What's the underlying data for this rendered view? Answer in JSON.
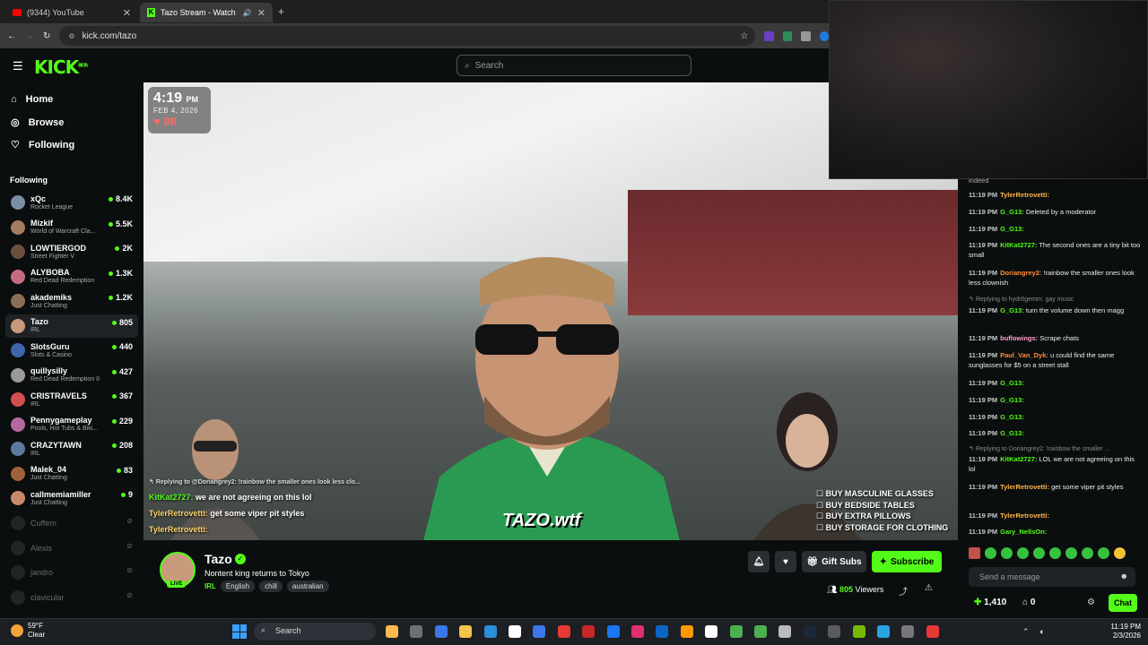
{
  "browser": {
    "tabs": [
      {
        "label": "(9344) YouTube",
        "active": false
      },
      {
        "label": "Tazo Stream - Watch Live o",
        "active": true
      }
    ],
    "url": "kick.com/tazo"
  },
  "kick": {
    "logo": "KICK",
    "logo_badge": "BETA",
    "search_placeholder": "Search"
  },
  "sidebar": {
    "nav": [
      {
        "label": "Home",
        "icon": "home-icon"
      },
      {
        "label": "Browse",
        "icon": "compass-icon"
      },
      {
        "label": "Following",
        "icon": "heart-icon"
      }
    ],
    "section_title": "Following",
    "channels": [
      {
        "name": "xQc",
        "category": "Rocket League",
        "viewers": "8.4K",
        "color": "#7a8fa3"
      },
      {
        "name": "Mizkif",
        "category": "World of Warcraft Cla...",
        "viewers": "5.5K",
        "color": "#a47c62"
      },
      {
        "name": "LOWTIERGOD",
        "category": "Street Fighter V",
        "viewers": "2K",
        "color": "#6c4f3d"
      },
      {
        "name": "ALYBOBA",
        "category": "Red Dead Redemption",
        "viewers": "1.3K",
        "color": "#c56b80"
      },
      {
        "name": "akademiks",
        "category": "Just Chatting",
        "viewers": "1.2K",
        "color": "#8a6f55"
      },
      {
        "name": "Tazo",
        "category": "IRL",
        "viewers": "805",
        "color": "#c89b7b",
        "active": true
      },
      {
        "name": "SlotsGuru",
        "category": "Slots & Casino",
        "viewers": "440",
        "color": "#3c66a8"
      },
      {
        "name": "quillysilly",
        "category": "Red Dead Redemption II",
        "viewers": "427",
        "color": "#9a9a9a"
      },
      {
        "name": "CRISTRAVELS",
        "category": "IRL",
        "viewers": "367",
        "color": "#d24f4f"
      },
      {
        "name": "Pennygameplay",
        "category": "Pools, Hot Tubs & Biki...",
        "viewers": "229",
        "color": "#b46aa0"
      },
      {
        "name": "CRAZYTAWN",
        "category": "IRL",
        "viewers": "208",
        "color": "#5d7a9c"
      },
      {
        "name": "Malek_04",
        "category": "Just Chatting",
        "viewers": "83",
        "color": "#a0623b"
      },
      {
        "name": "callmemiamiller",
        "category": "Just Chatting",
        "viewers": "9",
        "color": "#c88a6a"
      }
    ],
    "offline": [
      "Cuffem",
      "Alexis",
      "jandro",
      "clavicular"
    ]
  },
  "video": {
    "clock_time": "4:19",
    "clock_ampm": "PM",
    "clock_date": "FEB 4, 2026",
    "heart_rate": "98",
    "overlay_chat": [
      {
        "user": "",
        "text": "Replying to @Doriangrey2: !rainbow the smaller ones look less clo...",
        "reply": true
      },
      {
        "user": "KitKat2727:",
        "text": " we are not agreeing on this lol"
      },
      {
        "user": "TylerRetrovetti:",
        "text": " get some viper pit styles"
      },
      {
        "user": "TylerRetrovetti:",
        "text": ""
      }
    ],
    "todo": [
      "BUY MASCULINE GLASSES",
      "BUY BEDSIDE TABLES",
      "BUY EXTRA PILLOWS",
      "BUY STORAGE FOR CLOTHING"
    ],
    "watermark": "TAZO.wtf"
  },
  "streamer": {
    "name": "Tazo",
    "live_badge": "LIVE",
    "title": "Nontent king returns to Tokyo",
    "category": "IRL",
    "tags": [
      "English",
      "chill",
      "australian"
    ],
    "gift_label": "Gift Subs",
    "subscribe_label": "Subscribe",
    "viewers": "805",
    "viewers_label": "Viewers"
  },
  "chat": {
    "messages": [
      {
        "time": "11:19 PM",
        "user": "TylerRetrovetti:",
        "text": "",
        "color": "#ffb347"
      },
      {
        "time": "11:19 PM",
        "user": "G_G13:",
        "text": " Deleted by a moderator",
        "color": "#53fc18"
      },
      {
        "time": "11:19 PM",
        "user": "G_G13:",
        "text": "",
        "color": "#53fc18"
      },
      {
        "time": "11:19 PM",
        "user": "KitKat2727:",
        "text": " The second ones are a tiny bit too small",
        "color": "#53fc18"
      },
      {
        "time": "11:19 PM",
        "user": "Doriangrey2:",
        "text": " !rainbow the smaller ones look less clownish",
        "color": "#ff8c3a"
      },
      {
        "time": "",
        "user": "",
        "text": "Replying to hydr0gemm: gay music",
        "color": "#8a8a8a",
        "reply": true
      },
      {
        "time": "11:19 PM",
        "user": "G_G13:",
        "text": " turn the volume down then magg",
        "color": "#53fc18"
      },
      {
        "time": "11:19 PM",
        "user": "buflowings:",
        "text": " Scrape chats",
        "color": "#ff9fd0"
      },
      {
        "time": "11:19 PM",
        "user": "Paul_Van_Dyk:",
        "text": " u could find the same sunglasses for $5 on a street stall",
        "color": "#ff8c3a"
      },
      {
        "time": "11:19 PM",
        "user": "G_G13:",
        "text": "",
        "color": "#53fc18"
      },
      {
        "time": "11:19 PM",
        "user": "G_G13:",
        "text": "",
        "color": "#53fc18"
      },
      {
        "time": "11:19 PM",
        "user": "G_G13:",
        "text": "",
        "color": "#53fc18"
      },
      {
        "time": "11:19 PM",
        "user": "G_G13:",
        "text": "",
        "color": "#53fc18"
      },
      {
        "time": "",
        "user": "",
        "text": "Replying to Doriangrey2: !rainbow the smaller ...",
        "color": "#8a8a8a",
        "reply": true
      },
      {
        "time": "11:19 PM",
        "user": "KitKat2727:",
        "text": " LOL we are not agreeing on this lol",
        "color": "#53fc18"
      },
      {
        "time": "11:19 PM",
        "user": "TylerRetrovetti:",
        "text": " get some viper pit styles",
        "color": "#ffb347"
      },
      {
        "time": "11:19 PM",
        "user": "TylerRetrovetti:",
        "text": "",
        "color": "#ffb347"
      },
      {
        "time": "11:19 PM",
        "user": "Gary_NellsOn:",
        "text": "",
        "color": "#53fc18"
      }
    ],
    "partial_top": "indeed",
    "send_placeholder": "Send a message",
    "points": "1,410",
    "store_count": "0",
    "chat_button": "Chat"
  },
  "taskbar": {
    "temp": "59°F",
    "weather": "Clear",
    "search": "Search",
    "time": "11:19 PM",
    "date": "2/3/2026"
  },
  "colors": {
    "accent": "#53fc18",
    "bg": "#0b0e0f"
  }
}
